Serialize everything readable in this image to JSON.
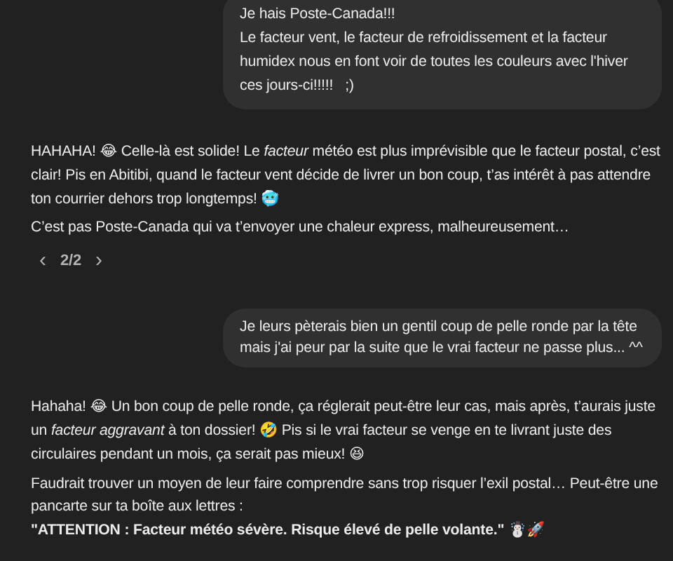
{
  "messages": [
    {
      "kind": "user",
      "text": "Je hais Poste-Canada!!!\nLe facteur vent, le facteur de refroidissement et la facteur humidex nous en font voir de toutes les couleurs avec l'hiver ces jours-ci!!!!!   ;)"
    },
    {
      "kind": "assistant",
      "paragraphs": [
        "HAHAHA! 😂 Celle-là est solide! Le *facteur* météo est plus imprévisible que le facteur postal, c’est clair! Pis en Abitibi, quand le facteur vent décide de livrer un bon coup, t’as intérêt à pas attendre ton courrier dehors trop longtemps! 🥶",
        "C’est pas Poste-Canada qui va t’envoyer une chaleur express, malheureusement…"
      ],
      "pager": {
        "prev": "‹",
        "label": "2/2",
        "next": "›"
      }
    },
    {
      "kind": "user",
      "text": "Je leurs pèterais bien un gentil coup de pelle ronde par la tête mais j'ai peur par la suite que le vrai facteur ne passe plus... ^^"
    },
    {
      "kind": "assistant",
      "paragraphs": [
        "Hahaha! 😂 Un bon coup de pelle ronde, ça réglerait peut-être leur cas, mais après, t’aurais juste un *facteur aggravant* à ton dossier! 🤣 Pis si le vrai facteur se venge en te livrant juste des circulaires pendant un mois, ça serait pas mieux! 😆",
        "Faudrait trouver un moyen de leur faire comprendre sans trop risquer l’exil postal… Peut-être une pancarte sur ta boîte aux lettres :\n**\"ATTENTION : Facteur météo sévère. Risque élevé de pelle volante.\"** ☃️🚀"
      ]
    }
  ]
}
